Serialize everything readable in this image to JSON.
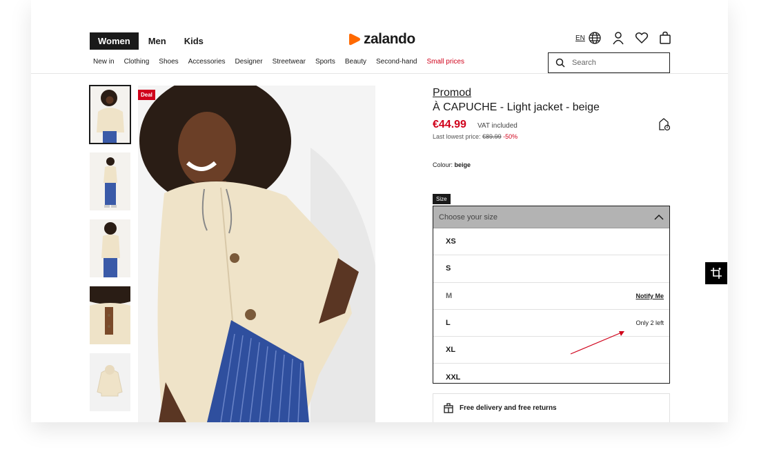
{
  "header": {
    "gender_tabs": [
      {
        "label": "Women",
        "active": true
      },
      {
        "label": "Men",
        "active": false
      },
      {
        "label": "Kids",
        "active": false
      }
    ],
    "logo_text": "zalando",
    "language": "EN",
    "search_placeholder": "Search",
    "categories": [
      "New in",
      "Clothing",
      "Shoes",
      "Accessories",
      "Designer",
      "Streetwear",
      "Sports",
      "Beauty",
      "Second-hand",
      "Small prices"
    ],
    "icons": [
      "globe-icon",
      "account-icon",
      "wishlist-icon",
      "bag-icon",
      "search-icon"
    ]
  },
  "gallery": {
    "deal_badge": "Deal",
    "thumbnail_count": 5
  },
  "product": {
    "brand": "Promod",
    "name": "À CAPUCHE - Light jacket - beige",
    "price": "€44.99",
    "vat_text": "VAT included",
    "lowest_label": "Last lowest price:",
    "lowest_price": "€89.99",
    "discount": "-50%",
    "colour_label": "Colour:",
    "colour_value": "beige"
  },
  "size_selector": {
    "tag": "Size",
    "placeholder": "Choose your size",
    "options": [
      {
        "label": "XS",
        "note": ""
      },
      {
        "label": "S",
        "note": ""
      },
      {
        "label": "M",
        "note": "Notify Me"
      },
      {
        "label": "L",
        "note": "Only 2 left"
      },
      {
        "label": "XL",
        "note": ""
      },
      {
        "label": "XXL",
        "note": ""
      }
    ]
  },
  "delivery_text": "Free delivery and free returns",
  "colors": {
    "accent": "#d0021b",
    "brand_orange": "#ff6900",
    "dark": "#1a1a1a"
  }
}
